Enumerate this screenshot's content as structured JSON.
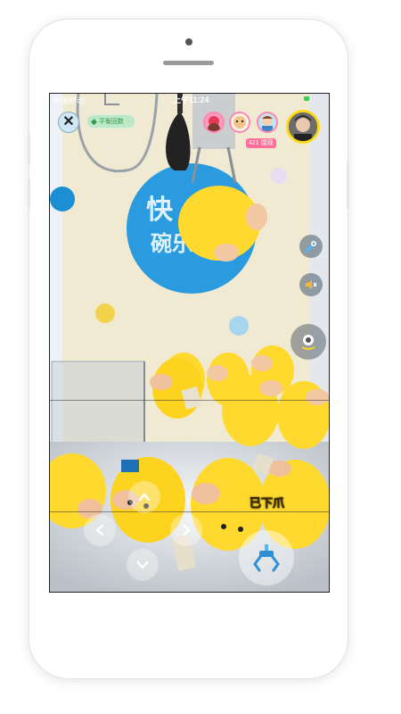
{
  "status_bar": {
    "carrier": "中国移动",
    "time": "上午11:24"
  },
  "top_bar": {
    "diamond_balance": "平衡回数",
    "viewer_count": "421 围观"
  },
  "backdrop": {
    "sign_line1": "快",
    "sign_line2": "碗乐"
  },
  "controls": {
    "grab_status": "已下爪"
  },
  "icons": {
    "close": "close-icon",
    "diamond": "diamond-icon",
    "wrench": "wrench-icon",
    "mute": "speaker-muted-icon",
    "camera_switch": "camera-switch-icon",
    "up": "chevron-up-icon",
    "down": "chevron-down-icon",
    "left": "chevron-left-icon",
    "right": "chevron-right-icon",
    "claw": "claw-icon"
  },
  "colors": {
    "host_ring": "#ffd814",
    "viewer_ring": "#ff86b2",
    "count_badge": "#ff6f9a",
    "plush_yellow": "#ffd92e"
  }
}
